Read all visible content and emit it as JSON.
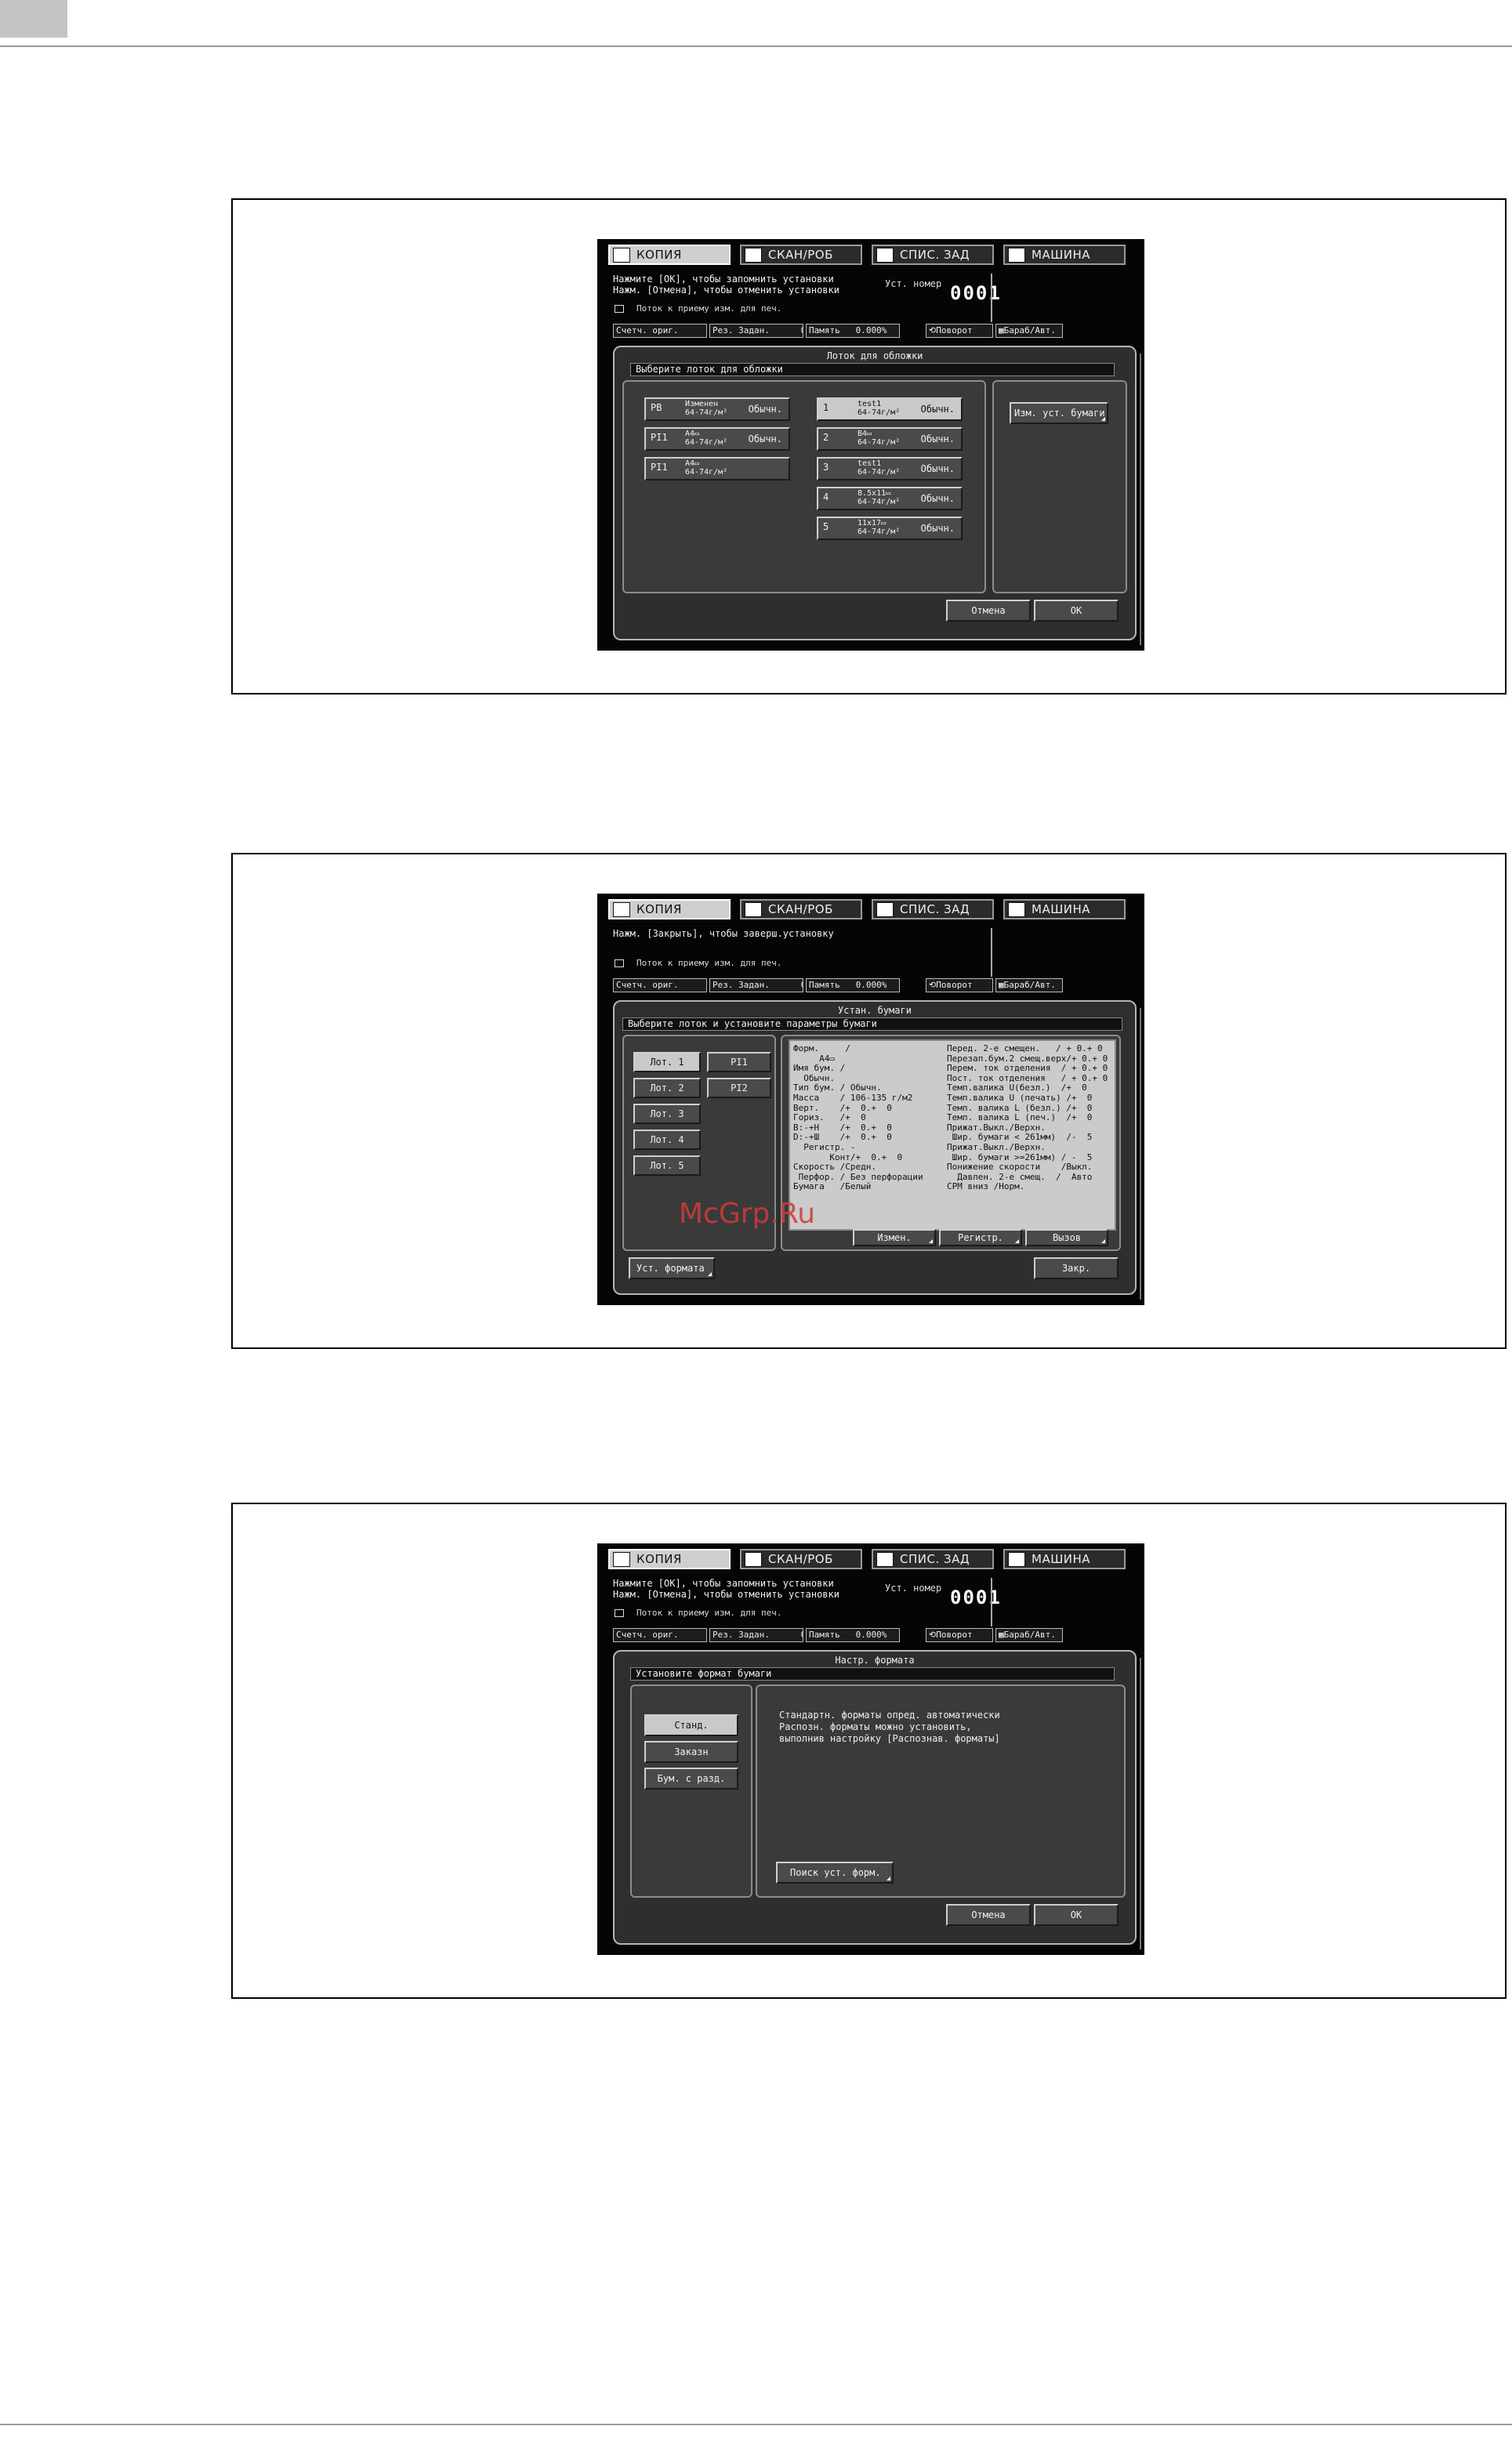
{
  "tabs": [
    "КОПИЯ",
    "СКАН/РОБ",
    "СПИС. ЗАД",
    "МАШИНА"
  ],
  "status_bar": [
    "Счетч. ориг.",
    "0",
    "Рез. Задан.",
    "0",
    "Память",
    "0.000%",
    "Поворот",
    "Бараб/Авт."
  ],
  "common": {
    "set_no_label": "Уст. номер",
    "set_no_value": "0001",
    "printer_status": "Поток к приему изм. для печ.",
    "msg_ok_1": "Нажмите [OK], чтобы запомнить установки",
    "msg_ok_2": "Нажм. [Отмена], чтобы отменить установки"
  },
  "screen1": {
    "panel_title": "Лоток для обложки",
    "instruction": "Выберите лоток для обложки",
    "left_trays": [
      {
        "name": "PB",
        "size": "Изменен",
        "weight": "64-74г/м²",
        "type": "Обычн."
      },
      {
        "name": "PI1",
        "size": "A4▭",
        "weight": "64-74г/м²",
        "type": "Обычн."
      },
      {
        "name": "PI1",
        "size": "A4▭",
        "weight": "64-74г/м²",
        "type": ""
      }
    ],
    "center_trays": [
      {
        "name": "1",
        "size": "test1",
        "weight": "64-74г/м²",
        "type": "Обычн."
      },
      {
        "name": "2",
        "size": "B4▭",
        "weight": "64-74г/м²",
        "type": "Обычн."
      },
      {
        "name": "3",
        "size": "test1",
        "weight": "64-74г/м²",
        "type": "Обычн."
      },
      {
        "name": "4",
        "size": "8.5x11▭",
        "weight": "64-74г/м²",
        "type": "Обычн."
      },
      {
        "name": "5",
        "size": "11x17▭",
        "weight": "64-74г/м²",
        "type": "Обычн."
      }
    ],
    "change_paper_button": "Изм. уст. бумаги",
    "cancel_button": "Отмена",
    "ok_button": "OK"
  },
  "screen2": {
    "message": "Нажм. [Закрыть], чтобы заверш.установку",
    "panel_title": "Устан. бумаги",
    "instruction": "Выберите лоток и установите параметры бумаги",
    "trays": [
      "Лот. 1",
      "Лот. 2",
      "Лот. 3",
      "Лот. 4",
      "Лот. 5"
    ],
    "pi_trays": [
      "PI1",
      "PI2"
    ],
    "info_left": [
      "Форм.     /",
      "     A4▭",
      "Имя бум. /",
      "  Обычн.",
      "Тип бум. / Обычн.",
      "Масса    / 106-135 г/м2",
      "Верт.    /+  0.+  0",
      "Гориз.   /+  0",
      "B:-+H    /+  0.+  0",
      "D:-+Ш    /+  0.+  0",
      "  Регистр. -",
      "       Конт/+  0.+  0",
      "Скорость /Средн.",
      " Перфор. / Без перфорации",
      "Бумага   /Белый"
    ],
    "info_right": [
      "Перед. 2-е смещен.   / + 0.+ 0",
      "Перезап.бум.2 смещ.верх/+ 0.+ 0",
      "Перем. ток отделения  / + 0.+ 0",
      "Пост. ток отделения   / + 0.+ 0",
      "Темп.валика U(безл.)  /+  0",
      "Темп.валика U (печать) /+  0",
      "Темп. валика L (безл.) /+  0",
      "Темп. валика L (печ.)  /+  0",
      "Прижат.Выкл./Верхн.",
      " Шир. бумаги < 261мм)  /-  5",
      "Прижат.Выкл./Верхн.",
      " Шир. бумаги >=261мм) / -  5",
      "Понижение скорости    /Выкл.",
      "  Давлен. 2-е смещ.  /  Авто",
      "CPM вниз /Норм."
    ],
    "edit_button": "Измен.",
    "register_button": "Регистр.",
    "recall_button": "Вызов",
    "format_button": "Уст. формата",
    "close_button": "Закр."
  },
  "screen3": {
    "panel_title": "Настр. формата",
    "instruction": "Установите формат бумаги",
    "options": [
      "Станд.",
      "Заказн",
      "Бум. с разд."
    ],
    "description": [
      "Стандартн. форматы опред. автоматически",
      "Распозн. форматы можно установить,",
      "выполнив настройку [Распознав. форматы]"
    ],
    "search_button": "Поиск уст. форм.",
    "cancel_button": "Отмена",
    "ok_button": "OK"
  },
  "watermark": "McGrp.Ru"
}
